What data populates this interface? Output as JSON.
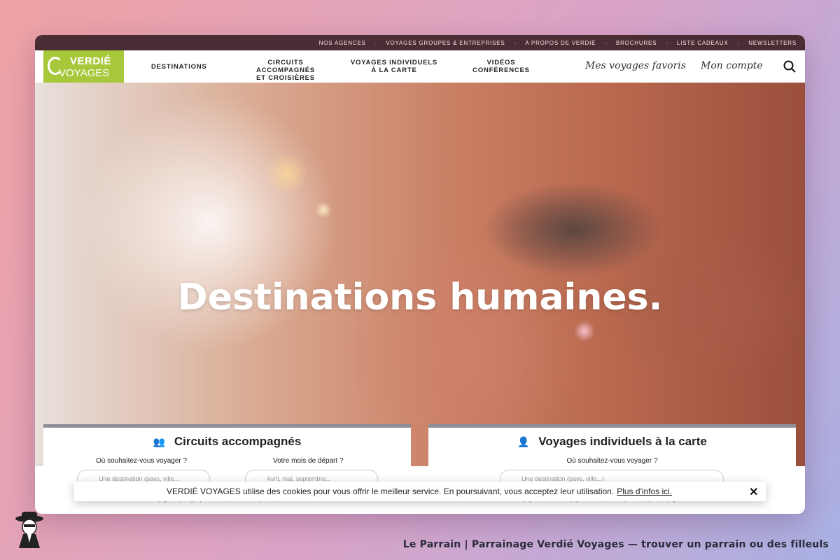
{
  "top_links": [
    "NOS AGENCES",
    "VOYAGES GROUPES & ENTREPRISES",
    "A PROPOS DE VERDIÉ",
    "BROCHURES",
    "LISTE CADEAUX",
    "NEWSLETTERS"
  ],
  "logo": {
    "line1": "VERDIÉ",
    "line2": "VOYAGES"
  },
  "nav": {
    "destinations": "DESTINATIONS",
    "circuits": [
      "CIRCUITS ACCOMPAGNÉS",
      "ET CROISIÈRES"
    ],
    "individuels": [
      "VOYAGES INDIVIDUELS",
      "À LA CARTE"
    ],
    "videos": [
      "VIDÉOS",
      "CONFÉRENCES"
    ],
    "favoris": "Mes voyages favoris",
    "compte": "Mon compte"
  },
  "hero": {
    "title": "Destinations humaines."
  },
  "panel_left": {
    "title": "Circuits accompagnés",
    "dest_label": "Où souhaitez-vous voyager ?",
    "dest_placeholder": "Une destination (pays, ville...",
    "month_label": "Votre mois de départ ?",
    "month_placeholder": "Avril, mai, septembre...",
    "fine": "Voyages en petit groupe : circuits, itinéraires d'exploration, croisières"
  },
  "panel_right": {
    "title": "Voyages individuels à la carte",
    "dest_label": "Où souhaitez-vous voyager ?",
    "dest_placeholder": "Une destination (pays, ville...)",
    "fine": "Voyages individuels : voyages itinérants, circuits privatifs, séjours, voyages sur mesure"
  },
  "cookie": {
    "text": "VERDIÉ VOYAGES utilise des cookies pour vous offrir le meilleur service. En poursuivant, vous acceptez leur utilisation.",
    "link": "Plus d'infos ici.",
    "close": "✕"
  },
  "caption": "Le Parrain | Parrainage Verdié Voyages — trouver un parrain ou des filleuls",
  "colors": {
    "brand_green": "#a8c83c",
    "topbar": "#4a2d34"
  }
}
